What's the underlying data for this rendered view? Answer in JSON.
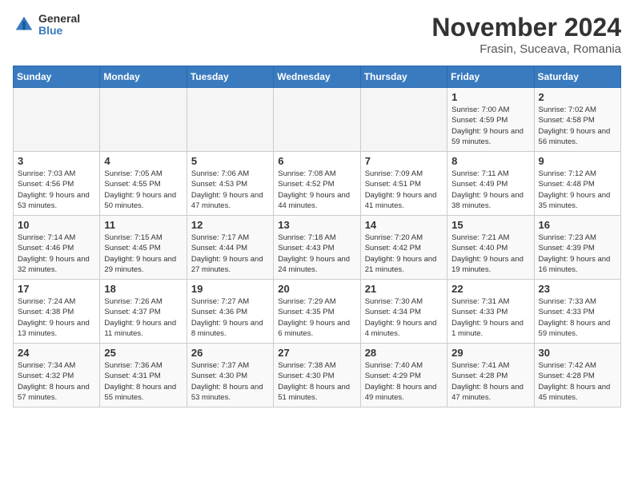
{
  "logo": {
    "general": "General",
    "blue": "Blue"
  },
  "title": "November 2024",
  "subtitle": "Frasin, Suceava, Romania",
  "headers": [
    "Sunday",
    "Monday",
    "Tuesday",
    "Wednesday",
    "Thursday",
    "Friday",
    "Saturday"
  ],
  "weeks": [
    [
      {
        "day": "",
        "info": ""
      },
      {
        "day": "",
        "info": ""
      },
      {
        "day": "",
        "info": ""
      },
      {
        "day": "",
        "info": ""
      },
      {
        "day": "",
        "info": ""
      },
      {
        "day": "1",
        "info": "Sunrise: 7:00 AM\nSunset: 4:59 PM\nDaylight: 9 hours and 59 minutes."
      },
      {
        "day": "2",
        "info": "Sunrise: 7:02 AM\nSunset: 4:58 PM\nDaylight: 9 hours and 56 minutes."
      }
    ],
    [
      {
        "day": "3",
        "info": "Sunrise: 7:03 AM\nSunset: 4:56 PM\nDaylight: 9 hours and 53 minutes."
      },
      {
        "day": "4",
        "info": "Sunrise: 7:05 AM\nSunset: 4:55 PM\nDaylight: 9 hours and 50 minutes."
      },
      {
        "day": "5",
        "info": "Sunrise: 7:06 AM\nSunset: 4:53 PM\nDaylight: 9 hours and 47 minutes."
      },
      {
        "day": "6",
        "info": "Sunrise: 7:08 AM\nSunset: 4:52 PM\nDaylight: 9 hours and 44 minutes."
      },
      {
        "day": "7",
        "info": "Sunrise: 7:09 AM\nSunset: 4:51 PM\nDaylight: 9 hours and 41 minutes."
      },
      {
        "day": "8",
        "info": "Sunrise: 7:11 AM\nSunset: 4:49 PM\nDaylight: 9 hours and 38 minutes."
      },
      {
        "day": "9",
        "info": "Sunrise: 7:12 AM\nSunset: 4:48 PM\nDaylight: 9 hours and 35 minutes."
      }
    ],
    [
      {
        "day": "10",
        "info": "Sunrise: 7:14 AM\nSunset: 4:46 PM\nDaylight: 9 hours and 32 minutes."
      },
      {
        "day": "11",
        "info": "Sunrise: 7:15 AM\nSunset: 4:45 PM\nDaylight: 9 hours and 29 minutes."
      },
      {
        "day": "12",
        "info": "Sunrise: 7:17 AM\nSunset: 4:44 PM\nDaylight: 9 hours and 27 minutes."
      },
      {
        "day": "13",
        "info": "Sunrise: 7:18 AM\nSunset: 4:43 PM\nDaylight: 9 hours and 24 minutes."
      },
      {
        "day": "14",
        "info": "Sunrise: 7:20 AM\nSunset: 4:42 PM\nDaylight: 9 hours and 21 minutes."
      },
      {
        "day": "15",
        "info": "Sunrise: 7:21 AM\nSunset: 4:40 PM\nDaylight: 9 hours and 19 minutes."
      },
      {
        "day": "16",
        "info": "Sunrise: 7:23 AM\nSunset: 4:39 PM\nDaylight: 9 hours and 16 minutes."
      }
    ],
    [
      {
        "day": "17",
        "info": "Sunrise: 7:24 AM\nSunset: 4:38 PM\nDaylight: 9 hours and 13 minutes."
      },
      {
        "day": "18",
        "info": "Sunrise: 7:26 AM\nSunset: 4:37 PM\nDaylight: 9 hours and 11 minutes."
      },
      {
        "day": "19",
        "info": "Sunrise: 7:27 AM\nSunset: 4:36 PM\nDaylight: 9 hours and 8 minutes."
      },
      {
        "day": "20",
        "info": "Sunrise: 7:29 AM\nSunset: 4:35 PM\nDaylight: 9 hours and 6 minutes."
      },
      {
        "day": "21",
        "info": "Sunrise: 7:30 AM\nSunset: 4:34 PM\nDaylight: 9 hours and 4 minutes."
      },
      {
        "day": "22",
        "info": "Sunrise: 7:31 AM\nSunset: 4:33 PM\nDaylight: 9 hours and 1 minute."
      },
      {
        "day": "23",
        "info": "Sunrise: 7:33 AM\nSunset: 4:33 PM\nDaylight: 8 hours and 59 minutes."
      }
    ],
    [
      {
        "day": "24",
        "info": "Sunrise: 7:34 AM\nSunset: 4:32 PM\nDaylight: 8 hours and 57 minutes."
      },
      {
        "day": "25",
        "info": "Sunrise: 7:36 AM\nSunset: 4:31 PM\nDaylight: 8 hours and 55 minutes."
      },
      {
        "day": "26",
        "info": "Sunrise: 7:37 AM\nSunset: 4:30 PM\nDaylight: 8 hours and 53 minutes."
      },
      {
        "day": "27",
        "info": "Sunrise: 7:38 AM\nSunset: 4:30 PM\nDaylight: 8 hours and 51 minutes."
      },
      {
        "day": "28",
        "info": "Sunrise: 7:40 AM\nSunset: 4:29 PM\nDaylight: 8 hours and 49 minutes."
      },
      {
        "day": "29",
        "info": "Sunrise: 7:41 AM\nSunset: 4:28 PM\nDaylight: 8 hours and 47 minutes."
      },
      {
        "day": "30",
        "info": "Sunrise: 7:42 AM\nSunset: 4:28 PM\nDaylight: 8 hours and 45 minutes."
      }
    ]
  ]
}
